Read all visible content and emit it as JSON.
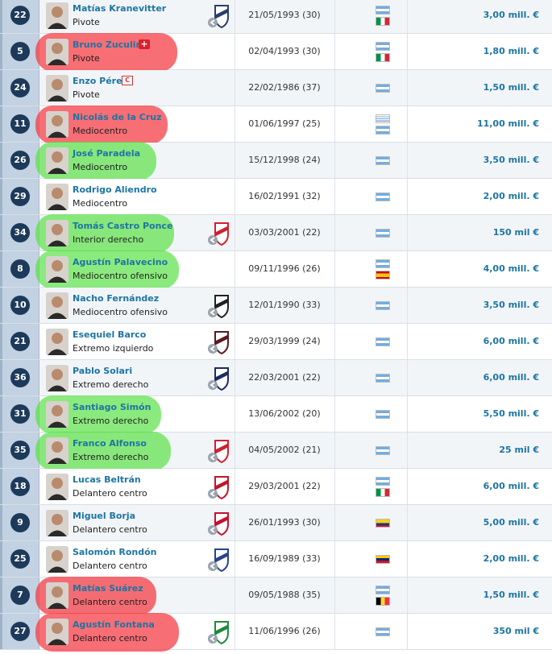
{
  "players": [
    {
      "number": "22",
      "name": "Matías Kranevitter",
      "position": "Pivote",
      "dob_age": "21/05/1993 (30)",
      "nationalities": [
        "argentina-flag",
        "italy-flag"
      ],
      "value": "3,00 mill. €",
      "highlight": "",
      "club_icon": "monterrey-crest"
    },
    {
      "number": "5",
      "name": "Bruno Zuculini",
      "position": "Pivote",
      "dob_age": "02/04/1993 (30)",
      "nationalities": [
        "argentina-flag",
        "italy-flag"
      ],
      "value": "1,80 mill. €",
      "highlight": "red",
      "status_icon": "injury-icon",
      "club_icon": ""
    },
    {
      "number": "24",
      "name": "Enzo Pérez",
      "position": "Pivote",
      "dob_age": "22/02/1986 (37)",
      "nationalities": [
        "argentina-flag"
      ],
      "value": "1,50 mill. €",
      "highlight": "",
      "status_icon": "captain-icon",
      "club_icon": ""
    },
    {
      "number": "11",
      "name": "Nicolás de la Cruz",
      "position": "Mediocentro",
      "dob_age": "01/06/1997 (25)",
      "nationalities": [
        "uruguay-flag",
        "argentina-flag"
      ],
      "value": "11,00 mill. €",
      "highlight": "red",
      "club_icon": ""
    },
    {
      "number": "26",
      "name": "José Paradela",
      "position": "Mediocentro",
      "dob_age": "15/12/1998 (24)",
      "nationalities": [
        "argentina-flag"
      ],
      "value": "3,50 mill. €",
      "highlight": "green",
      "club_icon": ""
    },
    {
      "number": "29",
      "name": "Rodrigo Aliendro",
      "position": "Mediocentro",
      "dob_age": "16/02/1991 (32)",
      "nationalities": [
        "argentina-flag"
      ],
      "value": "2,00 mill. €",
      "highlight": "",
      "club_icon": ""
    },
    {
      "number": "34",
      "name": "Tomás Castro Ponce",
      "position": "Interior derecho",
      "dob_age": "03/03/2001 (22)",
      "nationalities": [
        "argentina-flag"
      ],
      "value": "150 mil €",
      "highlight": "green",
      "club_icon": "river-plate-crest"
    },
    {
      "number": "8",
      "name": "Agustín Palavecino",
      "position": "Mediocentro ofensivo",
      "dob_age": "09/11/1996 (26)",
      "nationalities": [
        "argentina-flag",
        "spain-flag"
      ],
      "value": "4,00 mill. €",
      "highlight": "green",
      "club_icon": ""
    },
    {
      "number": "10",
      "name": "Nacho Fernández",
      "position": "Mediocentro ofensivo",
      "dob_age": "12/01/1990 (33)",
      "nationalities": [
        "argentina-flag"
      ],
      "value": "3,50 mill. €",
      "highlight": "",
      "club_icon": "atletico-mineiro-crest"
    },
    {
      "number": "21",
      "name": "Esequiel Barco",
      "position": "Extremo izquierdo",
      "dob_age": "29/03/1999 (24)",
      "nationalities": [
        "argentina-flag"
      ],
      "value": "6,00 mill. €",
      "highlight": "",
      "club_icon": "atlanta-united-crest"
    },
    {
      "number": "36",
      "name": "Pablo Solari",
      "position": "Extremo derecho",
      "dob_age": "22/03/2001 (22)",
      "nationalities": [
        "argentina-flag"
      ],
      "value": "6,00 mill. €",
      "highlight": "",
      "club_icon": "colo-colo-crest"
    },
    {
      "number": "31",
      "name": "Santiago Simón",
      "position": "Extremo derecho",
      "dob_age": "13/06/2002 (20)",
      "nationalities": [
        "argentina-flag"
      ],
      "value": "5,50 mill. €",
      "highlight": "green",
      "club_icon": ""
    },
    {
      "number": "35",
      "name": "Franco Alfonso",
      "position": "Extremo derecho",
      "dob_age": "04/05/2002 (21)",
      "nationalities": [
        "argentina-flag"
      ],
      "value": "25 mil €",
      "highlight": "green",
      "club_icon": "river-plate-crest"
    },
    {
      "number": "18",
      "name": "Lucas Beltrán",
      "position": "Delantero centro",
      "dob_age": "29/03/2001 (22)",
      "nationalities": [
        "argentina-flag",
        "italy-flag"
      ],
      "value": "6,00 mill. €",
      "highlight": "",
      "club_icon": "colon-crest"
    },
    {
      "number": "9",
      "name": "Miguel Borja",
      "position": "Delantero centro",
      "dob_age": "26/01/1993 (30)",
      "nationalities": [
        "colombia-flag"
      ],
      "value": "5,00 mill. €",
      "highlight": "",
      "club_icon": "junior-crest"
    },
    {
      "number": "25",
      "name": "Salomón Rondón",
      "position": "Delantero centro",
      "dob_age": "16/09/1989 (33)",
      "nationalities": [
        "venezuela-flag"
      ],
      "value": "2,00 mill. €",
      "highlight": "",
      "club_icon": "everton-crest"
    },
    {
      "number": "7",
      "name": "Matías Suárez",
      "position": "Delantero centro",
      "dob_age": "09/05/1988 (35)",
      "nationalities": [
        "argentina-flag",
        "belgium-flag"
      ],
      "value": "1,50 mill. €",
      "highlight": "red",
      "club_icon": ""
    },
    {
      "number": "27",
      "name": "Agustín Fontana",
      "position": "Delantero centro",
      "dob_age": "11/06/1996 (26)",
      "nationalities": [
        "argentina-flag"
      ],
      "value": "350 mil €",
      "highlight": "red",
      "club_icon": "defensa-y-justicia-crest"
    }
  ],
  "colors": {
    "link": "#1d75a3",
    "number_badge": "#1d3a5a",
    "highlight_red": "#f44048",
    "highlight_green": "#5ae146"
  }
}
